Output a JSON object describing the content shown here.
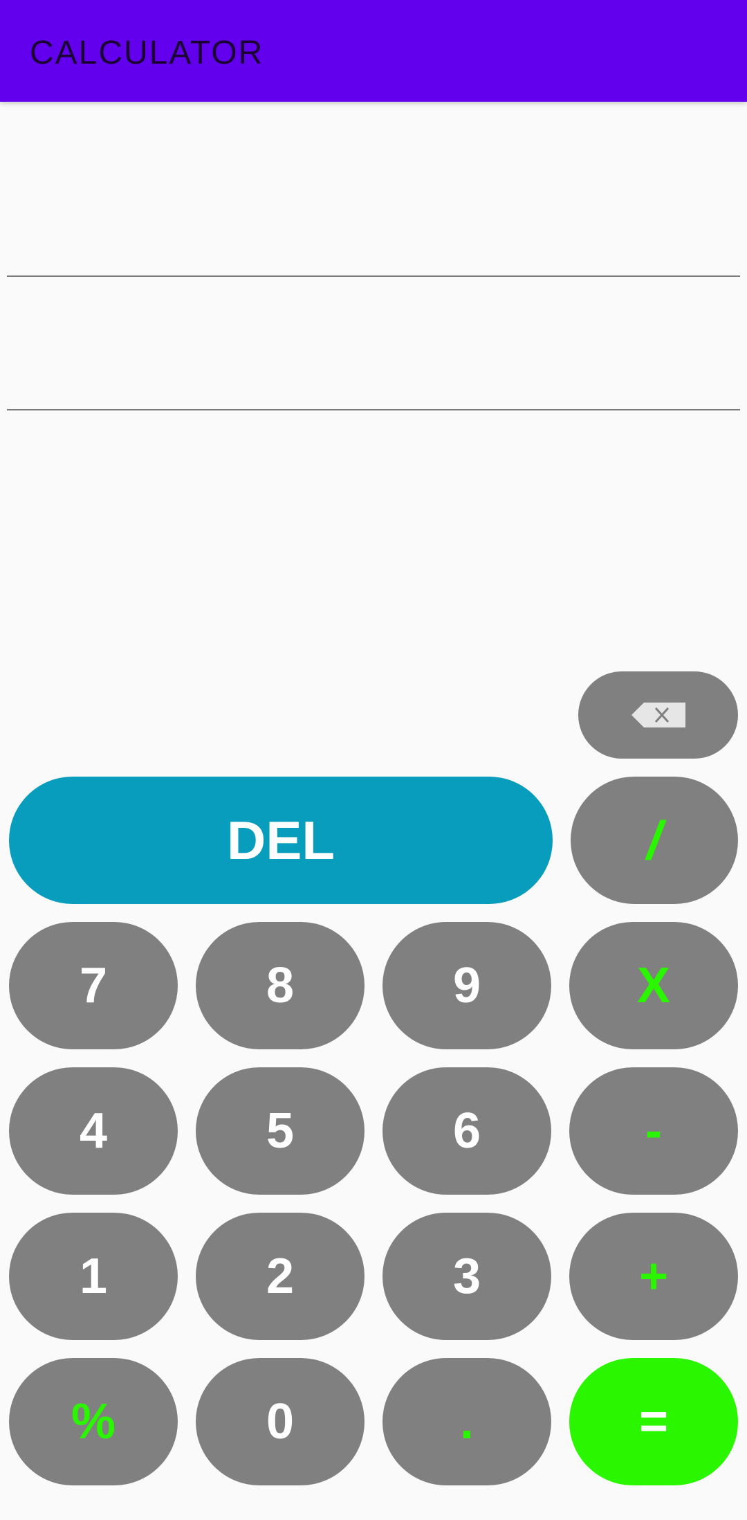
{
  "app_bar": {
    "title": "CALCULATOR",
    "color": "#6200ee"
  },
  "display": {
    "expression_value": "",
    "result_value": ""
  },
  "keys": {
    "backspace_icon": "backspace-icon",
    "del": "DEL",
    "divide": "/",
    "seven": "7",
    "eight": "8",
    "nine": "9",
    "multiply": "X",
    "four": "4",
    "five": "5",
    "six": "6",
    "minus": "-",
    "one": "1",
    "two": "2",
    "three": "3",
    "plus": "+",
    "percent": "%",
    "zero": "0",
    "dot": ".",
    "equals": "="
  },
  "colors": {
    "key_background": "#808080",
    "del_background": "#089cbd",
    "operator_text": "#2af600",
    "equals_background": "#2af600",
    "background": "#fafafa"
  }
}
